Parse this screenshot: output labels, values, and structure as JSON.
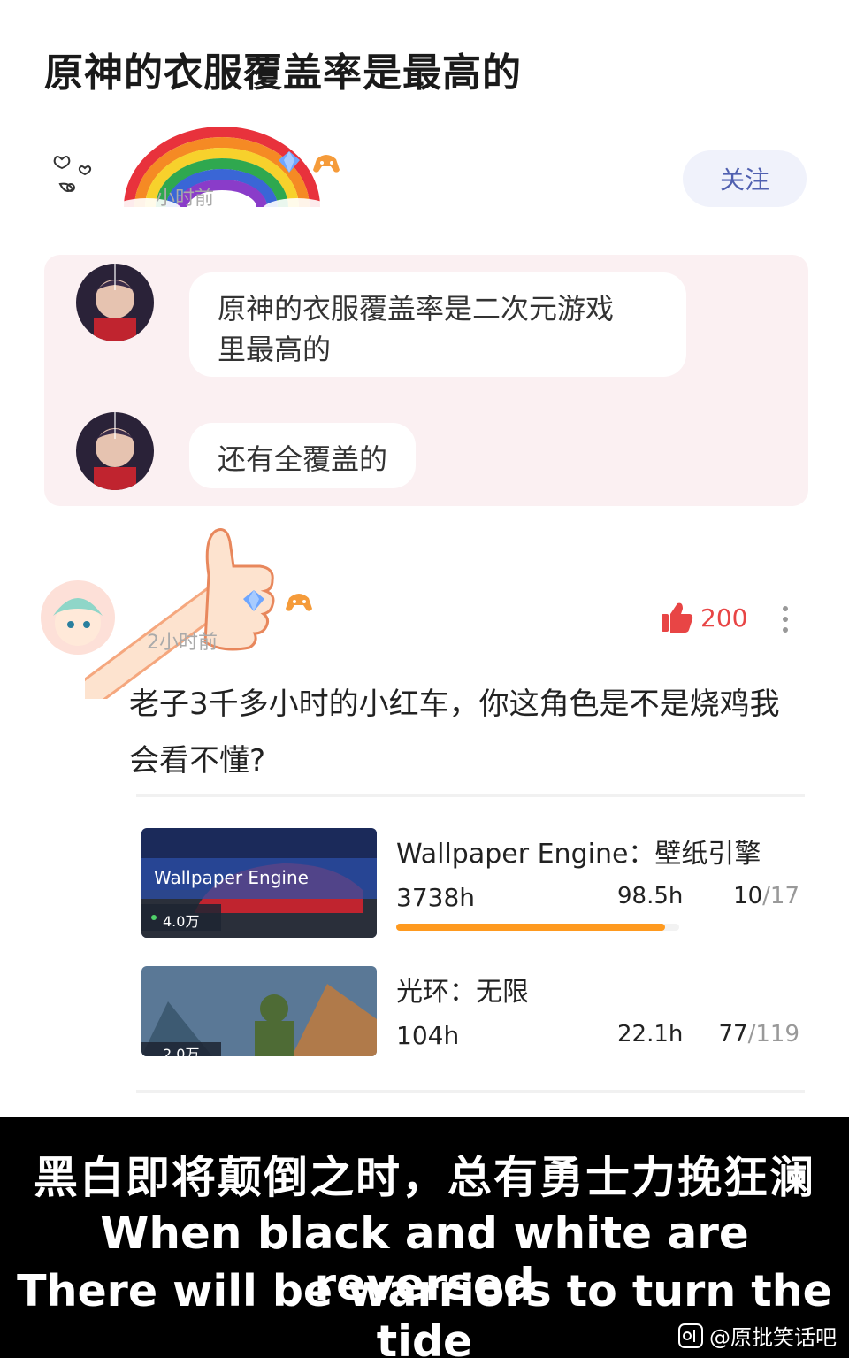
{
  "post": {
    "title": "原神的衣服覆盖率是最高的"
  },
  "author": {
    "time": "小时前",
    "follow_label": "关注"
  },
  "quote": {
    "messages": [
      {
        "text_line1": "原神的衣服覆盖率是二次元游戏",
        "text_line2": "里最高的"
      },
      {
        "text_line1": "还有全覆盖的"
      }
    ]
  },
  "comment": {
    "time": "2小时前",
    "likes": "200",
    "text": "老子3千多小时的小红车，你这角色是不是烧鸡我会看不懂?"
  },
  "games": [
    {
      "name": "Wallpaper  Engine：壁纸引擎",
      "thumb_title": "Wallpaper Engine",
      "thumb_count": "4.0万",
      "total": "3738h",
      "recent": "98.5h",
      "ach_num": "10",
      "ach_den": "/17",
      "progress": 0.95
    },
    {
      "name": "光环：无限",
      "thumb_count": "2.0万",
      "total": "104h",
      "recent": "22.1h",
      "ach_num": "77",
      "ach_den": "/119"
    }
  ],
  "subtitle": {
    "zh": "黑白即将颠倒之时，总有勇士力挽狂澜",
    "en1": "When black and white are reversed",
    "en2": "There will be warriors to turn the tide",
    "credit": "@原批笑话吧"
  },
  "colors": {
    "like": "#e84545",
    "progress": "#ff9a1f",
    "follow_text": "#5060b0"
  }
}
